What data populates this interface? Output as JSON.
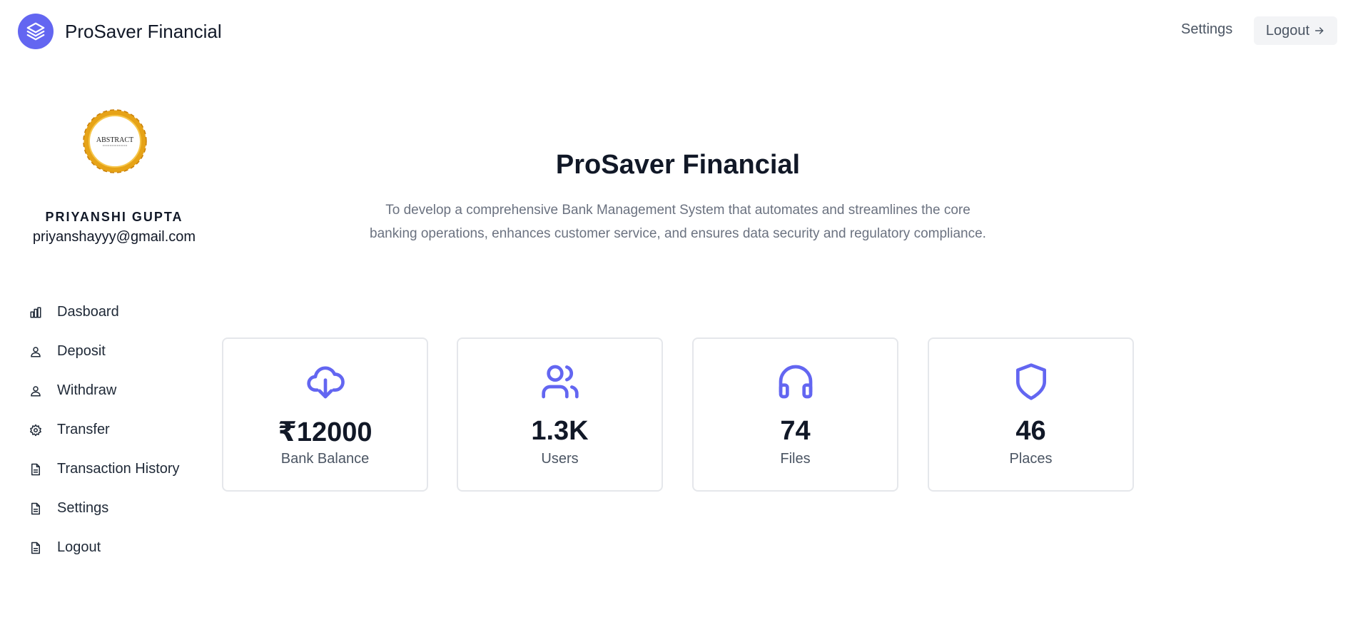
{
  "header": {
    "brand_name": "ProSaver Financial",
    "settings_label": "Settings",
    "logout_label": "Logout"
  },
  "sidebar": {
    "avatar_text": "ABSTRACT",
    "user_name": "PRIYANSHI GUPTA",
    "user_email": "priyanshayyy@gmail.com",
    "items": [
      {
        "label": "Dasboard",
        "icon": "bar-chart-icon"
      },
      {
        "label": "Deposit",
        "icon": "user-icon"
      },
      {
        "label": "Withdraw",
        "icon": "user-icon"
      },
      {
        "label": "Transfer",
        "icon": "gear-icon"
      },
      {
        "label": "Transaction History",
        "icon": "document-icon"
      },
      {
        "label": "Settings",
        "icon": "document-icon"
      },
      {
        "label": "Logout",
        "icon": "document-icon"
      }
    ]
  },
  "main": {
    "title": "ProSaver Financial",
    "description": "To develop a comprehensive Bank Management System that automates and streamlines the core banking operations, enhances customer service, and ensures data security and regulatory compliance.",
    "stats": [
      {
        "value": "₹12000",
        "label": "Bank Balance",
        "icon": "cloud-download-icon"
      },
      {
        "value": "1.3K",
        "label": "Users",
        "icon": "users-icon"
      },
      {
        "value": "74",
        "label": "Files",
        "icon": "headphones-icon"
      },
      {
        "value": "46",
        "label": "Places",
        "icon": "shield-icon"
      }
    ]
  },
  "colors": {
    "accent": "#6366f1",
    "text": "#111827",
    "muted": "#6b7280",
    "card_border": "#e5e7eb",
    "avatar_ring": "#e6a317"
  }
}
